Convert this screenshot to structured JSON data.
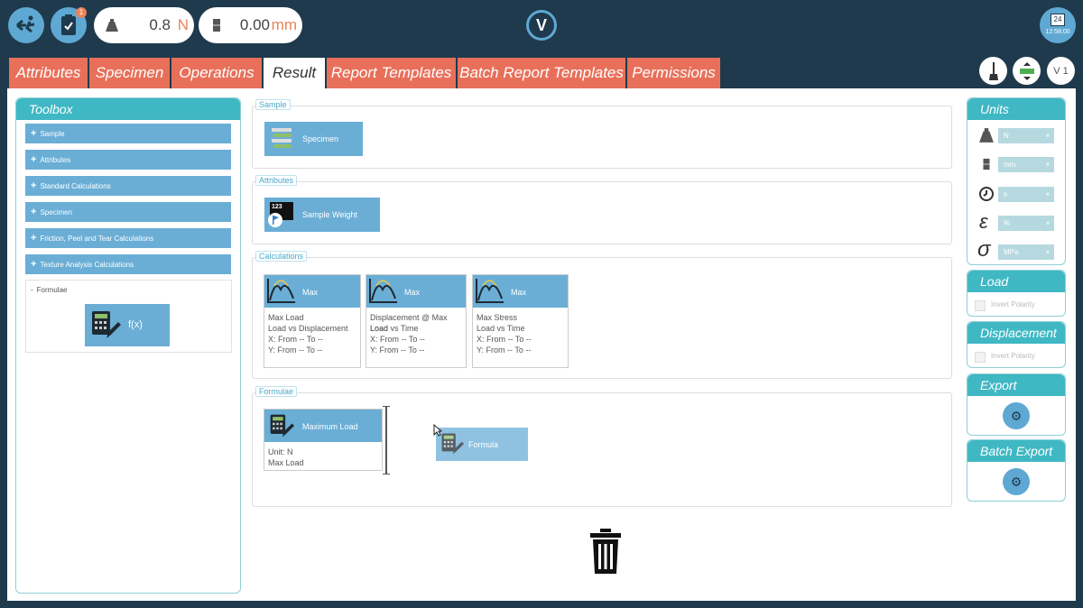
{
  "top": {
    "load_value": "0.8",
    "load_unit": "N",
    "disp_value": "0.00",
    "disp_unit": "mm",
    "badge_count": "1",
    "logo": "V",
    "calendar_day": "24",
    "clock_time": "12:58:00"
  },
  "tabs": [
    {
      "label": "Attributes"
    },
    {
      "label": "Specimen"
    },
    {
      "label": "Operations"
    },
    {
      "label": "Result"
    },
    {
      "label": "Report Templates"
    },
    {
      "label": "Batch Report Templates"
    },
    {
      "label": "Permissions"
    }
  ],
  "active_tab": "Result",
  "version_label": "V 1",
  "toolbox": {
    "title": "Toolbox",
    "items": [
      {
        "label": "Sample"
      },
      {
        "label": "Attributes"
      },
      {
        "label": "Standard Calculations"
      },
      {
        "label": "Specimen"
      },
      {
        "label": "Friction, Peel and Tear Calculations"
      },
      {
        "label": "Texture Analysis Calculations"
      }
    ],
    "formulae": {
      "label": "Formulae",
      "block_label": "f(x)"
    }
  },
  "sections": {
    "sample": {
      "label": "Sample",
      "block": "Specimen"
    },
    "attributes": {
      "label": "Attributes",
      "block": "Sample Weight",
      "block_icon_text": "123"
    },
    "calculations": {
      "label": "Calculations",
      "cards": [
        {
          "title": "Max",
          "lines": [
            "Max Load",
            "Load vs Displacement",
            "X: From -- To --",
            "Y: From -- To --"
          ]
        },
        {
          "title": "Max",
          "lines": [
            "Displacement @ Max Load",
            "Load vs Time",
            "X: From -- To --",
            "Y: From -- To --"
          ]
        },
        {
          "title": "Max",
          "lines": [
            "Max Stress",
            "Load vs Time",
            "X: From -- To --",
            "Y: From -- To --"
          ]
        }
      ]
    },
    "formulae": {
      "label": "Formulae",
      "card": {
        "title": "Maximum Load",
        "lines": [
          "Unit: N",
          "Max Load"
        ]
      },
      "drag_block": "Formula"
    }
  },
  "units": {
    "title": "Units",
    "rows": [
      {
        "icon": "weight-icon",
        "value": "N"
      },
      {
        "icon": "displacement-icon",
        "value": "mm"
      },
      {
        "icon": "clock-icon",
        "value": "s"
      },
      {
        "icon": "strain-icon",
        "symbol": "ε",
        "value": "%"
      },
      {
        "icon": "stress-icon",
        "symbol": "σ",
        "value": "MPa"
      }
    ]
  },
  "load_panel": {
    "title": "Load",
    "checkbox_label": "Invert Polarity"
  },
  "displacement_panel": {
    "title": "Displacement",
    "checkbox_label": "Invert Polarity"
  },
  "export_panel": {
    "title": "Export"
  },
  "batch_export_panel": {
    "title": "Batch Export"
  },
  "colors": {
    "navy": "#1e3a4c",
    "tab_orange": "#e8705a",
    "teal_header": "#3fb8c4",
    "block_blue": "#6aaed6",
    "accent_orange": "#e8845a"
  }
}
